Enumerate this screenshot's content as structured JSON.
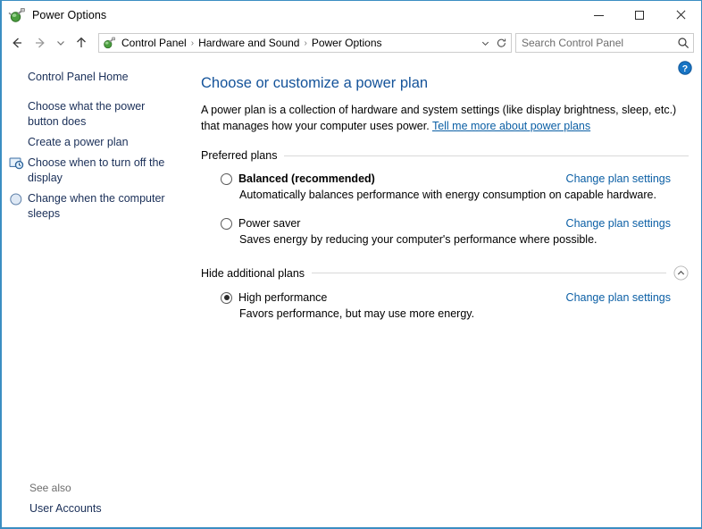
{
  "window": {
    "title": "Power Options",
    "icon": "power-plug-battery-icon",
    "controls": {
      "minimize": "Minimize",
      "maximize": "Maximize",
      "close": "Close"
    }
  },
  "navbar": {
    "back": "Back",
    "forward": "Forward",
    "recent": "Recent locations",
    "up": "Up one level",
    "breadcrumb": {
      "icon": "power-plug-battery-icon",
      "separator": "›",
      "items": [
        "Control Panel",
        "Hardware and Sound",
        "Power Options"
      ]
    },
    "address_dropdown": "chevron-down-icon",
    "refresh": "refresh-icon",
    "search": {
      "placeholder": "Search Control Panel",
      "value": "",
      "icon": "search-icon"
    }
  },
  "sidebar": {
    "items": [
      {
        "label": "Control Panel Home",
        "icon": ""
      },
      {
        "label": "Choose what the power button does",
        "icon": ""
      },
      {
        "label": "Create a power plan",
        "icon": ""
      },
      {
        "label": "Choose when to turn off the display",
        "icon": "display-clock-icon"
      },
      {
        "label": "Change when the computer sleeps",
        "icon": "sleep-moon-icon"
      }
    ],
    "see_also": {
      "title": "See also",
      "links": [
        "User Accounts"
      ]
    }
  },
  "content": {
    "help_button": "help-question-icon",
    "title": "Choose or customize a power plan",
    "description_before_link": "A power plan is a collection of hardware and system settings (like display brightness, sleep, etc.) that manages how your computer uses power. ",
    "description_link": "Tell me more about power plans",
    "sections": [
      {
        "header": "Preferred plans",
        "collapse_icon": "",
        "plans": [
          {
            "name": "Balanced (recommended)",
            "bold": true,
            "selected": false,
            "description": "Automatically balances performance with energy consumption on capable hardware.",
            "link": "Change plan settings"
          },
          {
            "name": "Power saver",
            "bold": false,
            "selected": false,
            "description": "Saves energy by reducing your computer's performance where possible.",
            "link": "Change plan settings"
          }
        ]
      },
      {
        "header": "Hide additional plans",
        "collapse_icon": "chevron-up-circle-icon",
        "plans": [
          {
            "name": "High performance",
            "bold": false,
            "selected": true,
            "description": "Favors performance, but may use more energy.",
            "link": "Change plan settings"
          }
        ]
      }
    ]
  },
  "colors": {
    "window_border": "#3b8ec2",
    "title_link": "#14539a",
    "hyperlink": "#0b5fa5",
    "sidebar_link": "#1a2f58",
    "rule": "#d9d9d9"
  }
}
